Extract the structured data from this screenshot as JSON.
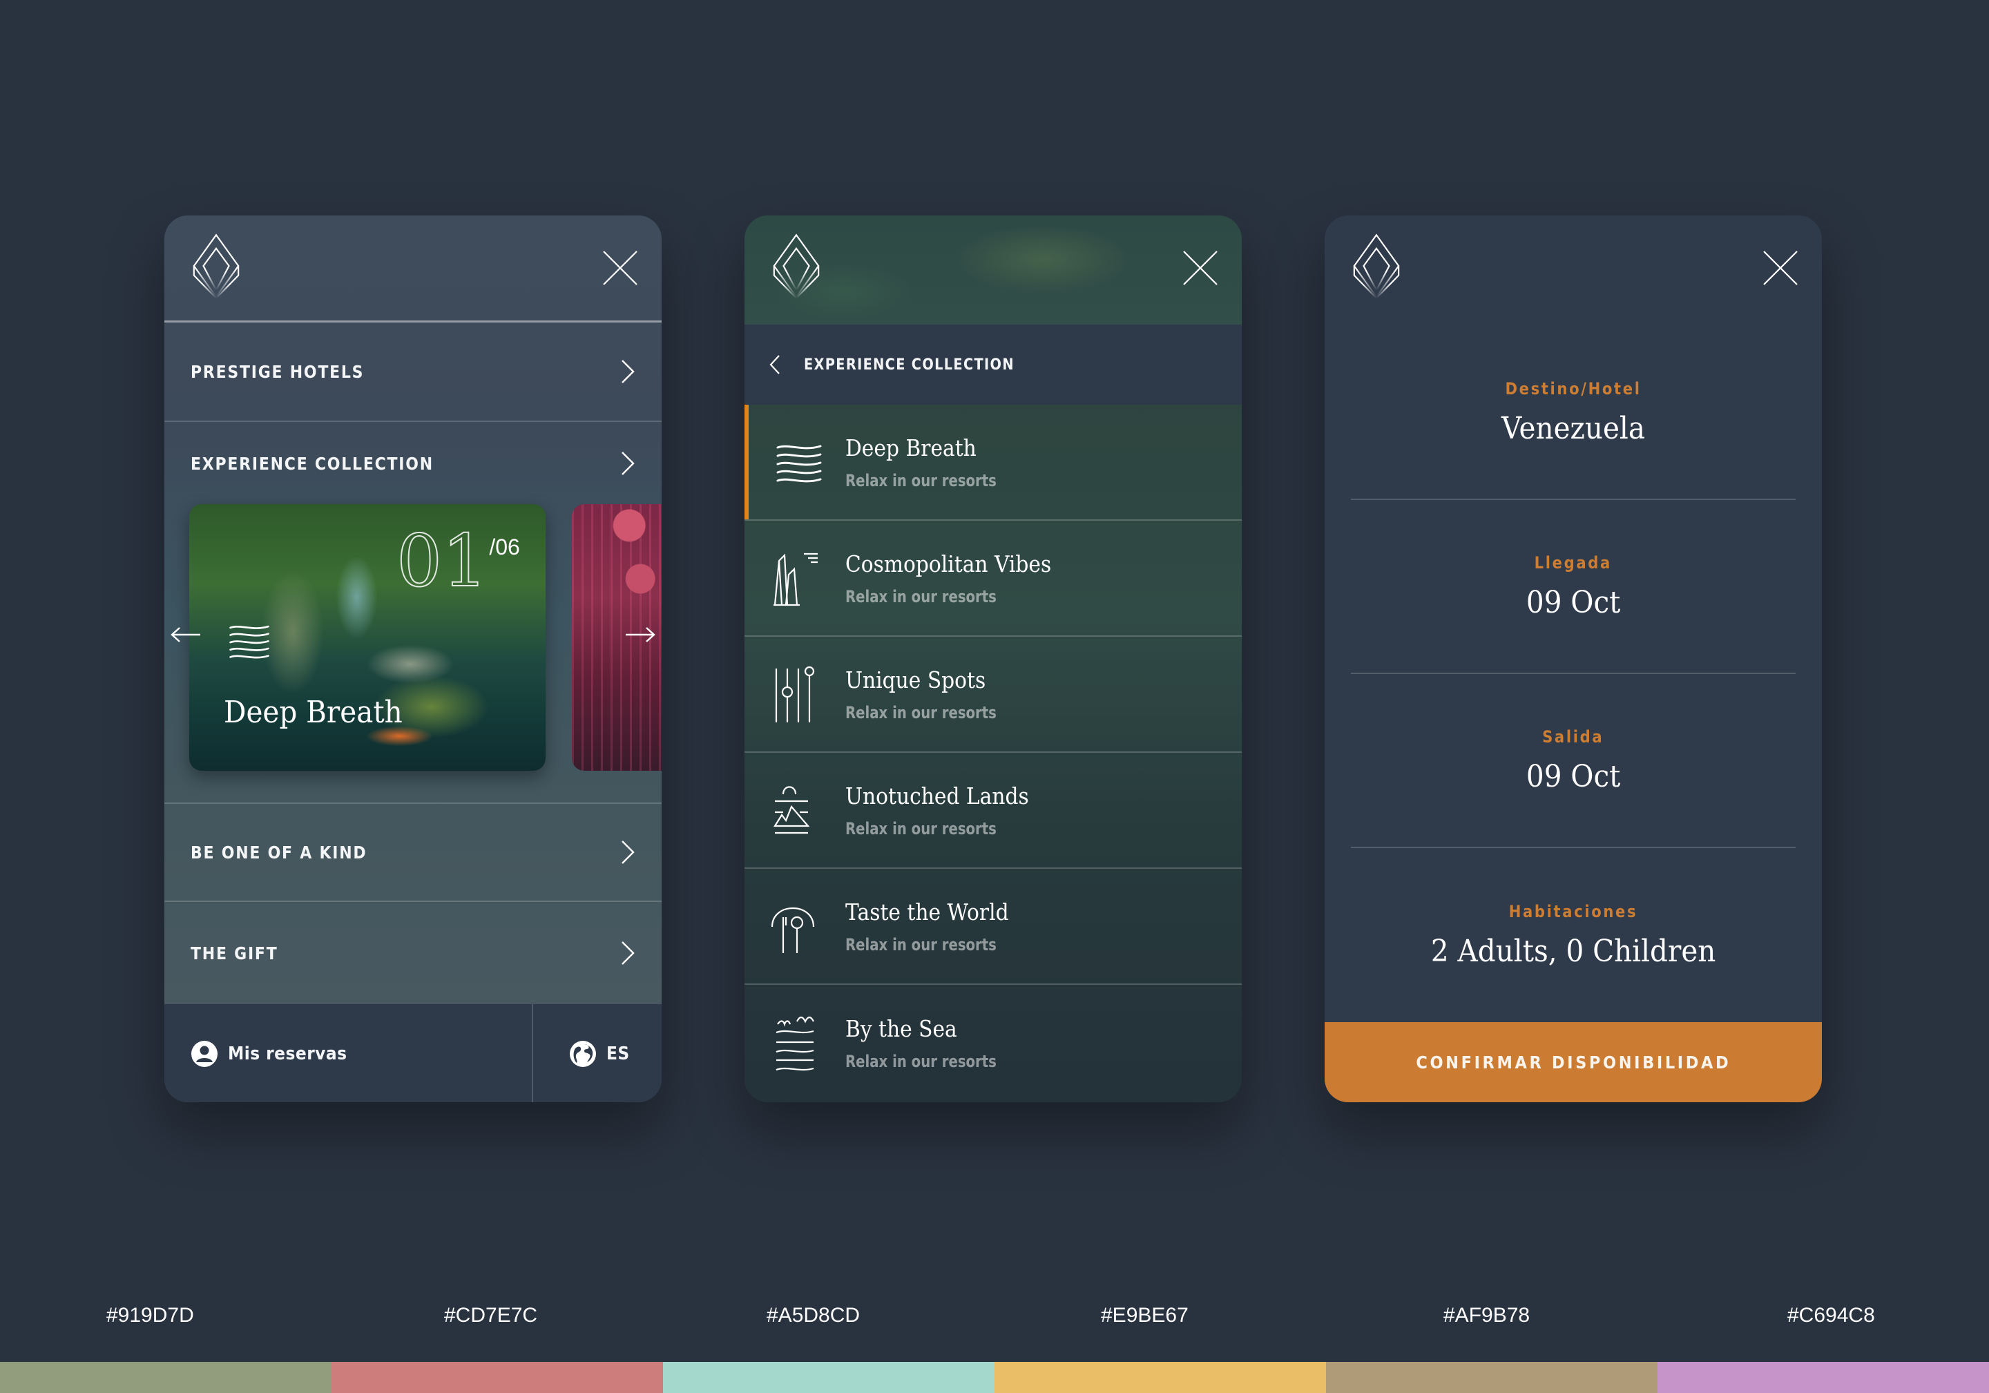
{
  "panels": {
    "menu": {
      "items": [
        {
          "label": "PRESTIGE HOTELS"
        },
        {
          "label": "EXPERIENCE COLLECTION"
        },
        {
          "label": "BE ONE OF A KIND"
        },
        {
          "label": "THE GIFT"
        }
      ],
      "carousel": {
        "current": "01",
        "total": "/06",
        "card_title": "Deep Breath",
        "card_icon": "waves-icon"
      },
      "footer": {
        "reservations_label": "Mis reservas",
        "reservations_icon": "user-icon",
        "language_label": "ES",
        "language_icon": "globe-icon"
      }
    },
    "experiences": {
      "back_label": "EXPERIENCE COLLECTION",
      "active_index": 0,
      "items": [
        {
          "title": "Deep Breath",
          "subtitle": "Relax in our resorts",
          "icon": "waves-icon"
        },
        {
          "title": "Cosmopolitan Vibes",
          "subtitle": "Relax in our resorts",
          "icon": "skyscrapers-icon"
        },
        {
          "title": "Unique Spots",
          "subtitle": "Relax in our resorts",
          "icon": "sliders-icon"
        },
        {
          "title": "Unotuched Lands",
          "subtitle": "Relax in our resorts",
          "icon": "mountain-sun-icon"
        },
        {
          "title": "Taste the World",
          "subtitle": "Relax in our resorts",
          "icon": "cutlery-icon"
        },
        {
          "title": "By the Sea",
          "subtitle": "Relax in our resorts",
          "icon": "sea-birds-icon"
        }
      ]
    },
    "booking": {
      "fields": [
        {
          "label": "Destino/Hotel",
          "value": "Venezuela"
        },
        {
          "label": "Llegada",
          "value": "09 Oct"
        },
        {
          "label": "Salida",
          "value": "09 Oct"
        },
        {
          "label": "Habitaciones",
          "value": "2 Adults, 0 Children"
        }
      ],
      "confirm_label": "CONFIRMAR DISPONIBILIDAD"
    }
  },
  "colors": {
    "accent": "#CB7B32",
    "active_bar": "#E0861C"
  },
  "palette": [
    {
      "hex": "#919D7D"
    },
    {
      "hex": "#CD7E7C"
    },
    {
      "hex": "#A5D8CD"
    },
    {
      "hex": "#E9BE67"
    },
    {
      "hex": "#AF9B78"
    },
    {
      "hex": "#C694C8"
    }
  ]
}
